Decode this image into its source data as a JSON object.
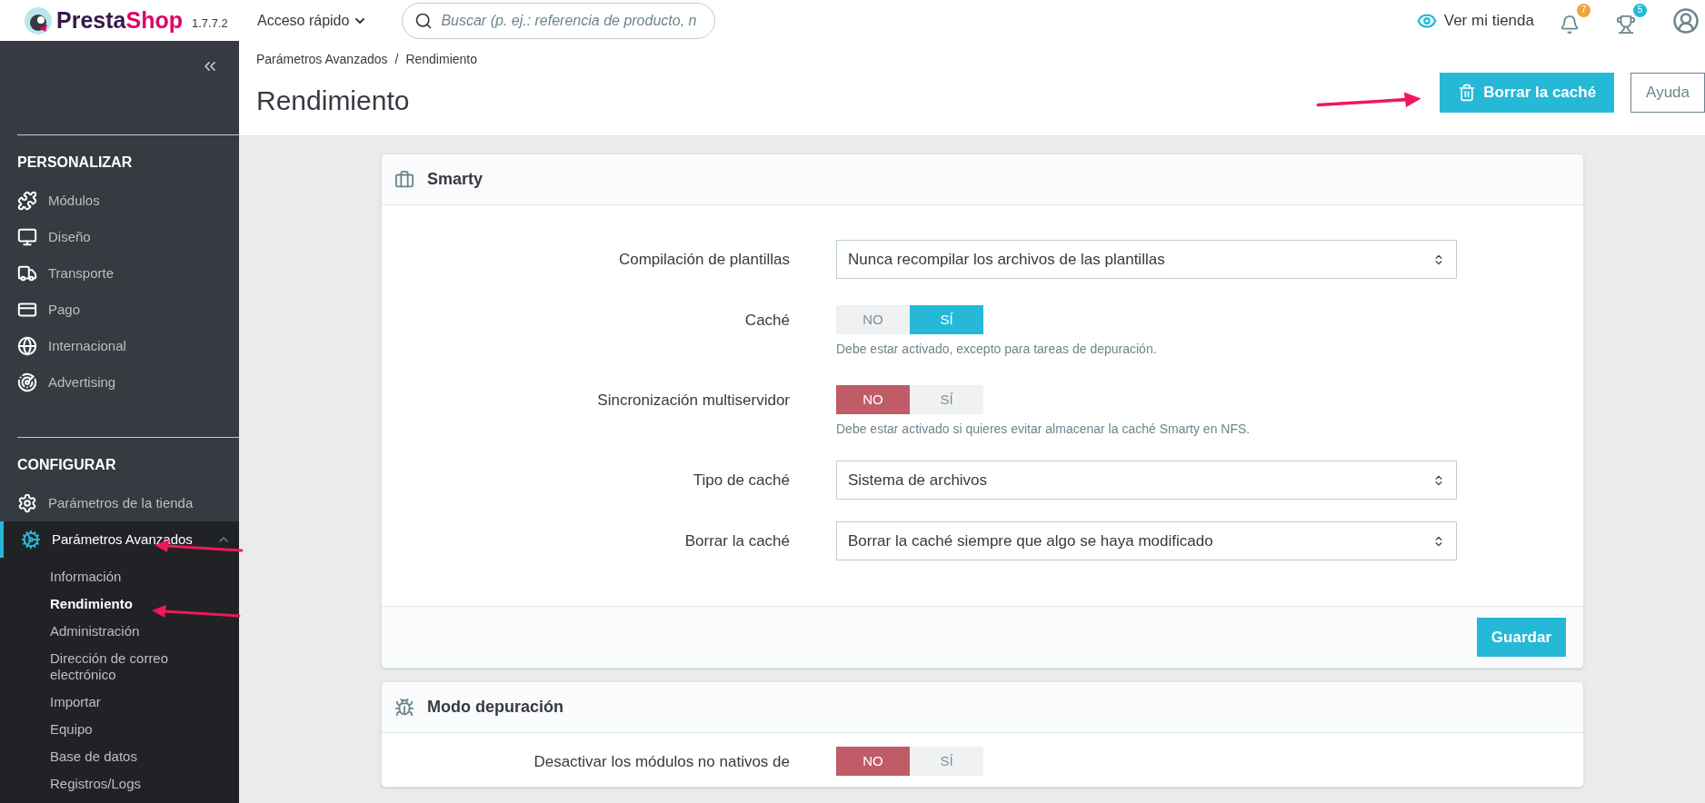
{
  "topbar": {
    "logo_parts": [
      "Presta",
      "Shop"
    ],
    "version": "1.7.7.2",
    "quick_access": "Acceso rápido",
    "search": {
      "placeholder": "Buscar (p. ej.: referencia de producto, n"
    },
    "view_store": "Ver mi tienda",
    "notifications": [
      {
        "count": "7",
        "color": "#f1a33c"
      },
      {
        "count": "5",
        "color": "#25b9d7"
      }
    ]
  },
  "sidebar": {
    "sections": [
      {
        "title": "PERSONALIZAR",
        "items": [
          {
            "label": "Módulos",
            "selected": false
          },
          {
            "label": "Diseño",
            "selected": false
          },
          {
            "label": "Transporte",
            "selected": false
          },
          {
            "label": "Pago",
            "selected": false
          },
          {
            "label": "Internacional",
            "selected": false
          },
          {
            "label": "Advertising",
            "selected": false
          }
        ]
      },
      {
        "title": "CONFIGURAR",
        "items": [
          {
            "label": "Parámetros de la tienda",
            "selected": false
          },
          {
            "label": "Parámetros Avanzados",
            "selected": true,
            "expanded": true,
            "children": [
              {
                "label": "Información",
                "selected": false
              },
              {
                "label": "Rendimiento",
                "selected": true
              },
              {
                "label": "Administración",
                "selected": false
              },
              {
                "label": "Dirección de correo electrónico",
                "selected": false
              },
              {
                "label": "Importar",
                "selected": false
              },
              {
                "label": "Equipo",
                "selected": false
              },
              {
                "label": "Base de datos",
                "selected": false
              },
              {
                "label": "Registros/Logs",
                "selected": false
              }
            ]
          }
        ]
      }
    ]
  },
  "header": {
    "breadcrumb": [
      "Parámetros Avanzados",
      "Rendimiento"
    ],
    "breadcrumb_separator": "/",
    "title": "Rendimiento",
    "actions": [
      {
        "label": "Borrar la caché",
        "kind": "primary"
      },
      {
        "label": "Ayuda",
        "kind": "outline"
      }
    ]
  },
  "cards": [
    {
      "title": "Smarty",
      "rows": [
        {
          "kind": "select",
          "label": "Compilación de plantillas",
          "value": "Nunca recompilar los archivos de las plantillas"
        },
        {
          "kind": "toggle",
          "label": "Caché",
          "options": [
            {
              "label": "NO",
              "selected": false
            },
            {
              "label": "SÍ",
              "selected": true
            }
          ],
          "hint": "Debe estar activado, excepto para tareas de depuración."
        },
        {
          "kind": "toggle",
          "label": "Sincronización multiservidor",
          "options": [
            {
              "label": "NO",
              "selected": true
            },
            {
              "label": "SÍ",
              "selected": false
            }
          ],
          "hint": "Debe estar activado si quieres evitar almacenar la caché Smarty en NFS."
        },
        {
          "kind": "select",
          "label": "Tipo de caché",
          "value": "Sistema de archivos"
        },
        {
          "kind": "select",
          "label": "Borrar la caché",
          "value": "Borrar la caché siempre que algo se haya modificado"
        }
      ],
      "save": "Guardar"
    },
    {
      "title": "Modo depuración",
      "rows": [
        {
          "kind": "toggle",
          "label": "Desactivar los módulos no nativos de",
          "options": [
            {
              "label": "NO",
              "selected": true
            },
            {
              "label": "SÍ",
              "selected": false
            }
          ]
        }
      ]
    }
  ]
}
